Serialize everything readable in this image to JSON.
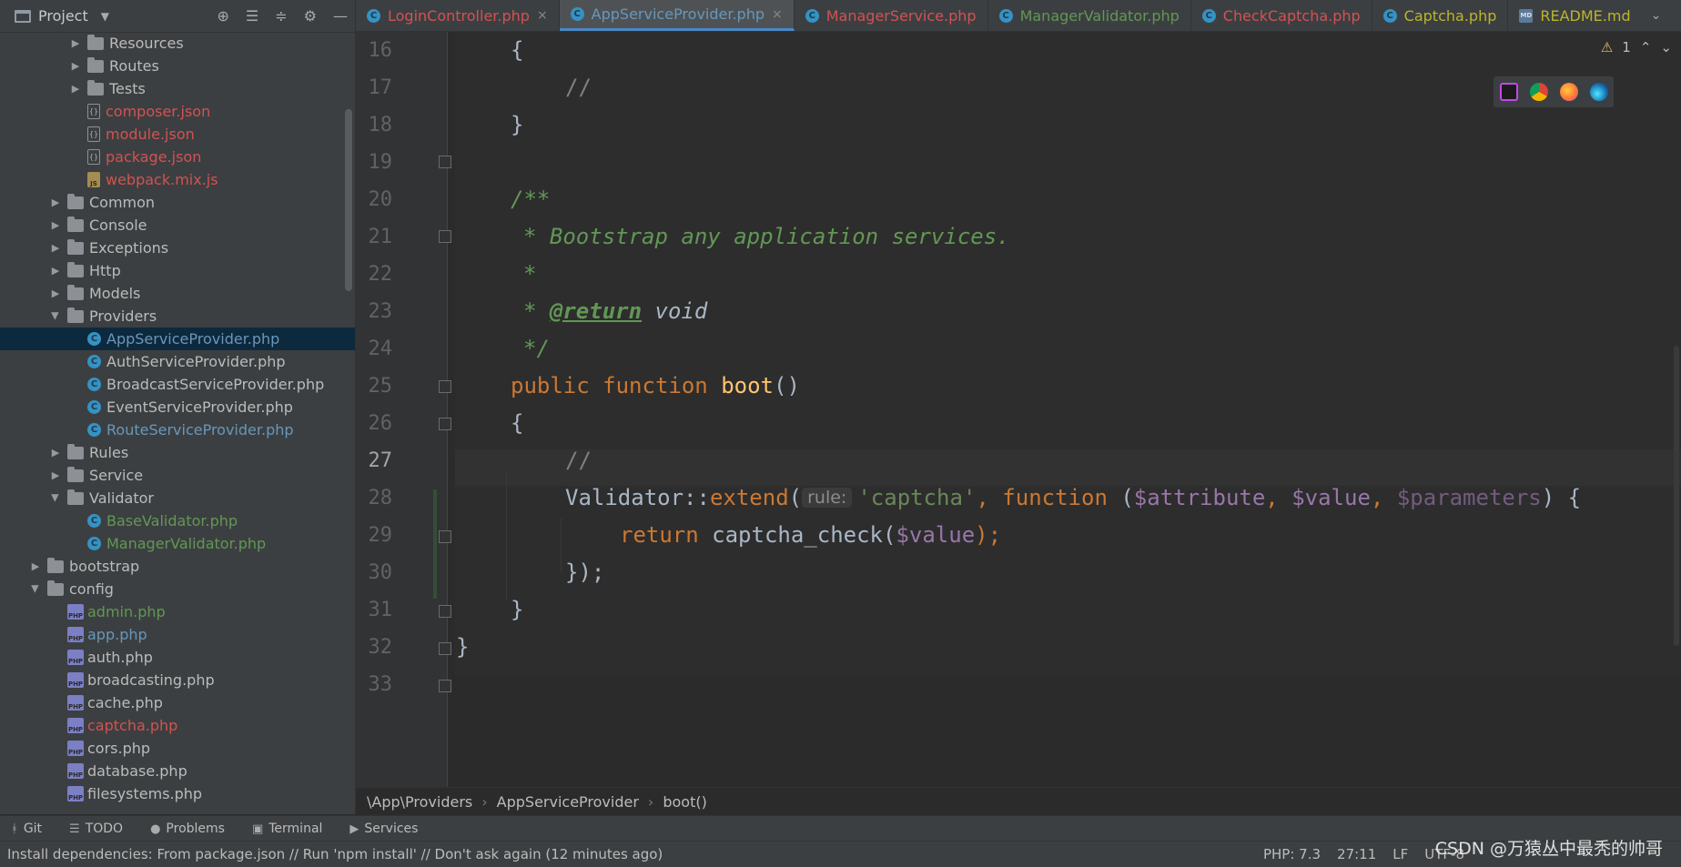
{
  "project_header": {
    "title": "Project",
    "chevron": "▼",
    "tool_icons": [
      "target-icon",
      "expand-all-icon",
      "collapse-all-icon",
      "gear-icon",
      "minimize-icon"
    ]
  },
  "tree": [
    {
      "label": "Resources",
      "type": "folder",
      "depth": 3,
      "state": "closed"
    },
    {
      "label": "Routes",
      "type": "folder",
      "depth": 3,
      "state": "closed"
    },
    {
      "label": "Tests",
      "type": "folder",
      "depth": 3,
      "state": "closed"
    },
    {
      "label": "composer.json",
      "type": "json",
      "depth": 3,
      "color": "red"
    },
    {
      "label": "module.json",
      "type": "json",
      "depth": 3,
      "color": "red"
    },
    {
      "label": "package.json",
      "type": "json",
      "depth": 3,
      "color": "red"
    },
    {
      "label": "webpack.mix.js",
      "type": "js",
      "depth": 3,
      "color": "red"
    },
    {
      "label": "Common",
      "type": "folder",
      "depth": 2,
      "state": "closed"
    },
    {
      "label": "Console",
      "type": "folder",
      "depth": 2,
      "state": "closed"
    },
    {
      "label": "Exceptions",
      "type": "folder",
      "depth": 2,
      "state": "closed"
    },
    {
      "label": "Http",
      "type": "folder",
      "depth": 2,
      "state": "closed"
    },
    {
      "label": "Models",
      "type": "folder",
      "depth": 2,
      "state": "closed"
    },
    {
      "label": "Providers",
      "type": "folder",
      "depth": 2,
      "state": "open"
    },
    {
      "label": "AppServiceProvider.php",
      "type": "class",
      "depth": 3,
      "color": "sel",
      "selected": true
    },
    {
      "label": "AuthServiceProvider.php",
      "type": "class",
      "depth": 3,
      "color": "norm"
    },
    {
      "label": "BroadcastServiceProvider.php",
      "type": "class",
      "depth": 3,
      "color": "norm"
    },
    {
      "label": "EventServiceProvider.php",
      "type": "class",
      "depth": 3,
      "color": "norm"
    },
    {
      "label": "RouteServiceProvider.php",
      "type": "class",
      "depth": 3,
      "color": "blue"
    },
    {
      "label": "Rules",
      "type": "folder",
      "depth": 2,
      "state": "closed"
    },
    {
      "label": "Service",
      "type": "folder",
      "depth": 2,
      "state": "closed"
    },
    {
      "label": "Validator",
      "type": "folder",
      "depth": 2,
      "state": "open"
    },
    {
      "label": "BaseValidator.php",
      "type": "class",
      "depth": 3,
      "color": "green"
    },
    {
      "label": "ManagerValidator.php",
      "type": "class",
      "depth": 3,
      "color": "green"
    },
    {
      "label": "bootstrap",
      "type": "folder",
      "depth": 1,
      "state": "closed"
    },
    {
      "label": "config",
      "type": "folder",
      "depth": 1,
      "state": "open"
    },
    {
      "label": "admin.php",
      "type": "php",
      "depth": 2,
      "color": "green"
    },
    {
      "label": "app.php",
      "type": "php",
      "depth": 2,
      "color": "blue"
    },
    {
      "label": "auth.php",
      "type": "php",
      "depth": 2,
      "color": "norm"
    },
    {
      "label": "broadcasting.php",
      "type": "php",
      "depth": 2,
      "color": "norm"
    },
    {
      "label": "cache.php",
      "type": "php",
      "depth": 2,
      "color": "norm"
    },
    {
      "label": "captcha.php",
      "type": "php",
      "depth": 2,
      "color": "red"
    },
    {
      "label": "cors.php",
      "type": "php",
      "depth": 2,
      "color": "norm"
    },
    {
      "label": "database.php",
      "type": "php",
      "depth": 2,
      "color": "norm"
    },
    {
      "label": "filesystems.php",
      "type": "php",
      "depth": 2,
      "color": "norm"
    }
  ],
  "tabs": [
    {
      "label": "LoginController.php",
      "color": "#d25252",
      "active": false,
      "closable": true,
      "icon": "class"
    },
    {
      "label": "AppServiceProvider.php",
      "color": "#6897bb",
      "active": true,
      "closable": true,
      "icon": "class"
    },
    {
      "label": "ManagerService.php",
      "color": "#d25252",
      "active": false,
      "closable": false,
      "icon": "class"
    },
    {
      "label": "ManagerValidator.php",
      "color": "#629755",
      "active": false,
      "closable": false,
      "icon": "class"
    },
    {
      "label": "CheckCaptcha.php",
      "color": "#d25252",
      "active": false,
      "closable": false,
      "icon": "class"
    },
    {
      "label": "Captcha.php",
      "color": "#bbb529",
      "active": false,
      "closable": false,
      "icon": "class"
    },
    {
      "label": "README.md",
      "color": "#bbb529",
      "active": false,
      "closable": false,
      "icon": "md"
    }
  ],
  "editor": {
    "warning_count": "1",
    "current_line": 27,
    "lines": [
      16,
      17,
      18,
      19,
      20,
      21,
      22,
      23,
      24,
      25,
      26,
      27,
      28,
      29,
      30,
      31,
      32,
      33
    ],
    "param_hint": "rule:",
    "code_tokens": {
      "l16": "{",
      "l17": "//",
      "l18": "}",
      "l20": "/**",
      "l21": "* Bootstrap any application services.",
      "l22": "*",
      "l23_star": "* ",
      "l23_tag": "@return",
      "l23_type": " void",
      "l24": "*/",
      "l25_public": "public ",
      "l25_function": "function ",
      "l25_name": "boot",
      "l25_paren": "()",
      "l26": "{",
      "l27": "//",
      "l28_cls": "Validator::",
      "l28_fn": "extend",
      "l28_open": "(",
      "l28_str": "'captcha'",
      "l28_comma": ", ",
      "l28_function": "function ",
      "l28_p1": "(",
      "l28_attr": "$attribute",
      "l28_c1": ", ",
      "l28_value": "$value",
      "l28_c2": ", ",
      "l28_params": "$parameters",
      "l28_end": ") {",
      "l29_return": "return ",
      "l29_call": "captcha_check(",
      "l29_var": "$value",
      "l29_end": ");",
      "l30_a": "});",
      "l31": "}",
      "l32": "}"
    }
  },
  "breadcrumb": [
    "\\App\\Providers",
    "AppServiceProvider",
    "boot()"
  ],
  "tool_windows": [
    {
      "label": "Git",
      "icon": "branch-icon"
    },
    {
      "label": "TODO",
      "icon": "list-icon"
    },
    {
      "label": "Problems",
      "icon": "info-icon"
    },
    {
      "label": "Terminal",
      "icon": "terminal-icon"
    },
    {
      "label": "Services",
      "icon": "play-icon"
    }
  ],
  "status": {
    "message": "Install dependencies: From package.json // Run 'npm install' // Don't ask again (12 minutes ago)",
    "php": "PHP: 7.3",
    "position": "27:11",
    "line_sep": "LF",
    "encoding": "UTF-8"
  },
  "watermark": "CSDN @万猿丛中最秃的帅哥"
}
